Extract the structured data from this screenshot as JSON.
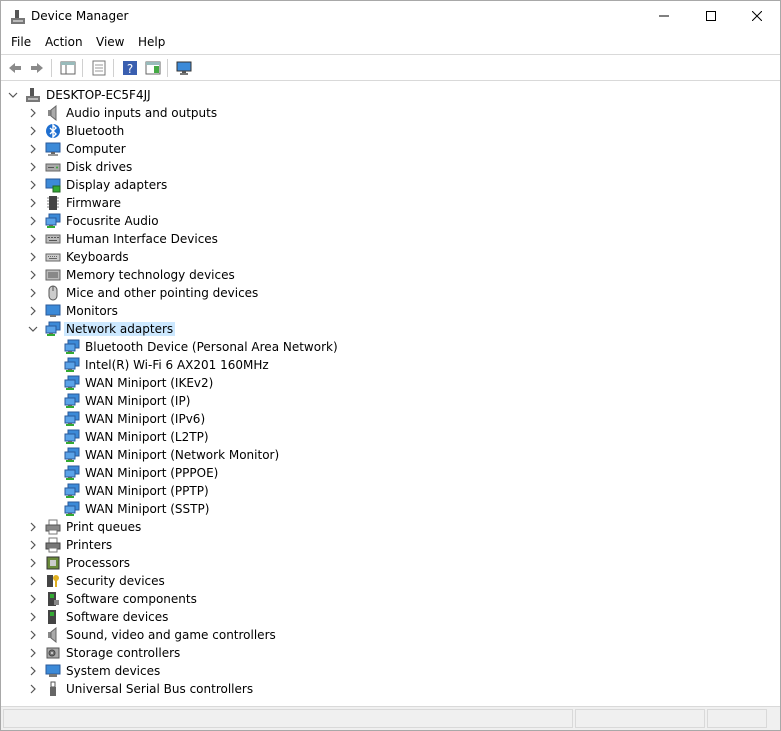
{
  "window": {
    "title": "Device Manager"
  },
  "menu": [
    "File",
    "Action",
    "View",
    "Help"
  ],
  "toolbar": [
    "back",
    "forward",
    "show-hide-console-tree",
    "properties",
    "help",
    "action-pane",
    "monitor"
  ],
  "tree": {
    "root": "DESKTOP-EC5F4JJ",
    "categories": [
      {
        "label": "Audio inputs and outputs",
        "icon": "speaker-icon"
      },
      {
        "label": "Bluetooth",
        "icon": "bluetooth-icon"
      },
      {
        "label": "Computer",
        "icon": "computer-icon"
      },
      {
        "label": "Disk drives",
        "icon": "disk-drive-icon"
      },
      {
        "label": "Display adapters",
        "icon": "display-adapter-icon"
      },
      {
        "label": "Firmware",
        "icon": "firmware-icon"
      },
      {
        "label": "Focusrite Audio",
        "icon": "network-icon"
      },
      {
        "label": "Human Interface Devices",
        "icon": "hid-icon"
      },
      {
        "label": "Keyboards",
        "icon": "keyboard-icon"
      },
      {
        "label": "Memory technology devices",
        "icon": "memory-icon"
      },
      {
        "label": "Mice and other pointing devices",
        "icon": "mouse-icon"
      },
      {
        "label": "Monitors",
        "icon": "monitor-icon"
      },
      {
        "label": "Network adapters",
        "icon": "network-icon",
        "expanded": true,
        "selected": true,
        "children": [
          "Bluetooth Device (Personal Area Network)",
          "Intel(R) Wi-Fi 6 AX201 160MHz",
          "WAN Miniport (IKEv2)",
          "WAN Miniport (IP)",
          "WAN Miniport (IPv6)",
          "WAN Miniport (L2TP)",
          "WAN Miniport (Network Monitor)",
          "WAN Miniport (PPPOE)",
          "WAN Miniport (PPTP)",
          "WAN Miniport (SSTP)"
        ]
      },
      {
        "label": "Print queues",
        "icon": "print-queue-icon"
      },
      {
        "label": "Printers",
        "icon": "printer-icon"
      },
      {
        "label": "Processors",
        "icon": "processor-icon"
      },
      {
        "label": "Security devices",
        "icon": "security-icon"
      },
      {
        "label": "Software components",
        "icon": "software-component-icon"
      },
      {
        "label": "Software devices",
        "icon": "software-device-icon"
      },
      {
        "label": "Sound, video and game controllers",
        "icon": "speaker-icon"
      },
      {
        "label": "Storage controllers",
        "icon": "storage-icon"
      },
      {
        "label": "System devices",
        "icon": "system-icon"
      },
      {
        "label": "Universal Serial Bus controllers",
        "icon": "usb-icon"
      }
    ]
  }
}
